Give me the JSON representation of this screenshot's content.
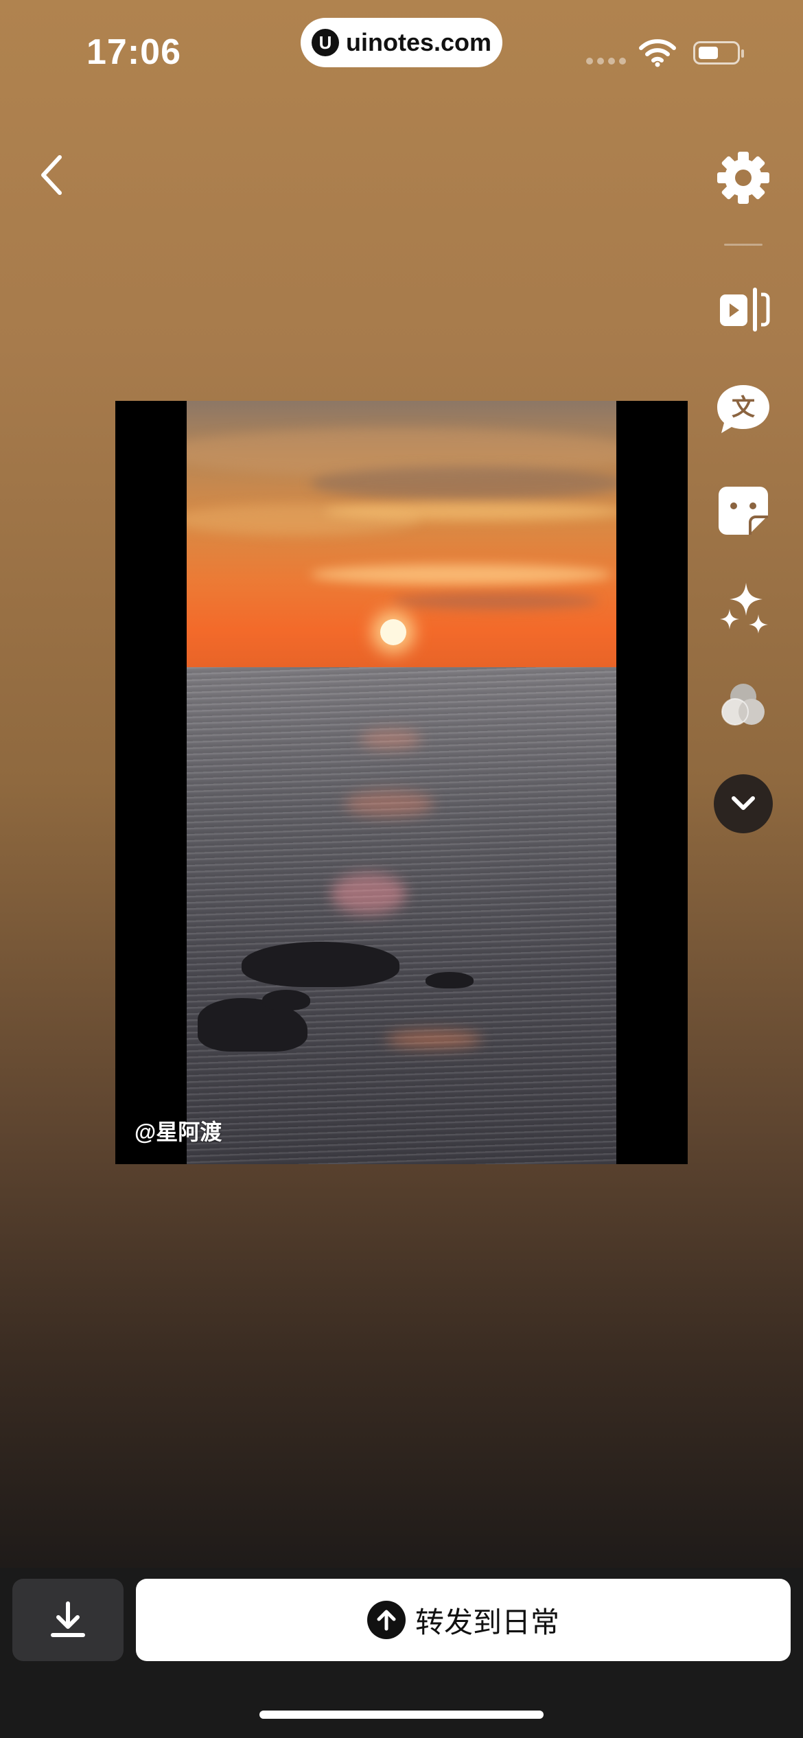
{
  "status_bar": {
    "time": "17:06",
    "site_logo_letter": "U",
    "site_domain": "uinotes.com"
  },
  "navigation": {
    "back_icon": "chevron-left-icon"
  },
  "toolbar": {
    "items": [
      {
        "icon": "gear-icon"
      },
      {
        "icon": "split-clip-icon"
      },
      {
        "icon": "text-bubble-icon",
        "glyph": "文"
      },
      {
        "icon": "sticker-icon"
      },
      {
        "icon": "sparkles-icon"
      },
      {
        "icon": "filters-icon"
      },
      {
        "icon": "chevron-down-icon"
      }
    ]
  },
  "media": {
    "watermark": "@星阿渡"
  },
  "actions": {
    "download_icon": "download-icon",
    "forward_label": "转发到日常",
    "forward_icon": "arrow-up-icon"
  }
}
